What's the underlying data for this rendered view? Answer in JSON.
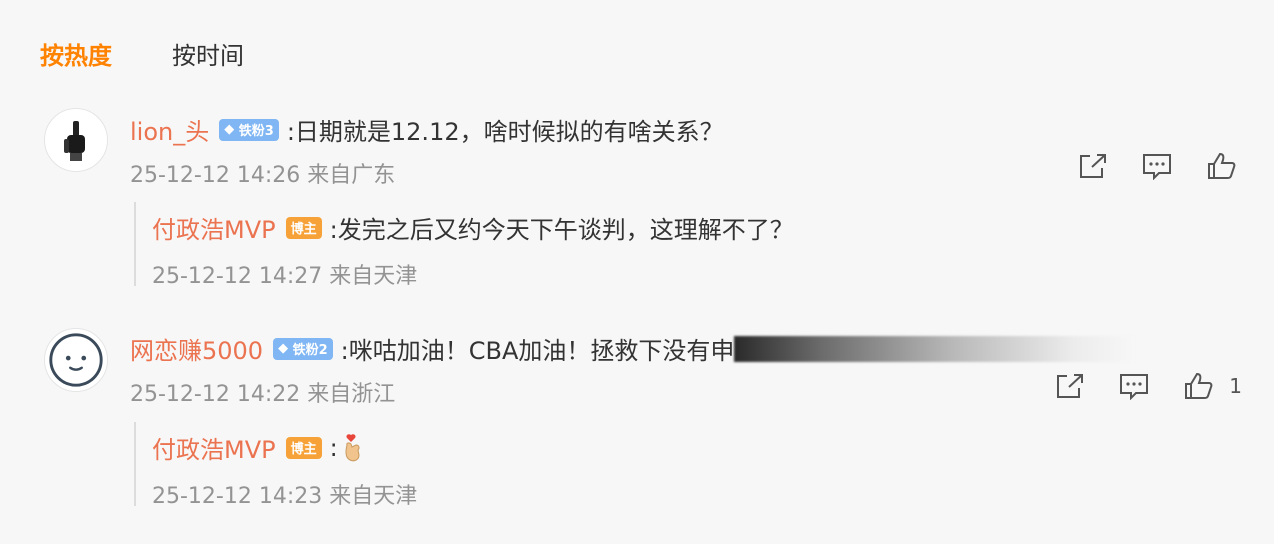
{
  "tabs": [
    {
      "label": "按热度",
      "active": true
    },
    {
      "label": "按时间",
      "active": false
    }
  ],
  "comments": [
    {
      "user": "lion_头",
      "badge": "铁粉3",
      "text": ":日期就是12.12，啥时候拟的有啥关系？",
      "time": "25-12-12 14:26 来自广东",
      "like_count": "",
      "reply": {
        "user": "付政浩MVP",
        "badge": "博主",
        "text": ":发完之后又约今天下午谈判，这理解不了？",
        "time": "25-12-12 14:27 来自天津"
      }
    },
    {
      "user": "网恋赚5000",
      "badge": "铁粉2",
      "text": ":咪咕加油！CBA加油！拯救下没有申",
      "time": "25-12-12 14:22 来自浙江",
      "like_count": "1",
      "reply": {
        "user": "付政浩MVP",
        "badge": "博主",
        "text": ":",
        "time": "25-12-12 14:23 来自天津"
      }
    }
  ],
  "icons": {
    "share": "share-icon",
    "comment": "comment-icon",
    "like": "thumbs-up-icon",
    "fan_badge": "diamond-icon",
    "finger_heart": "finger-heart-emoji"
  },
  "colors": {
    "accent": "#ff8200",
    "username": "#eb7350",
    "meta": "#939393",
    "fan_badge": "#7fb6f3",
    "host_badge": "#f7a238"
  }
}
